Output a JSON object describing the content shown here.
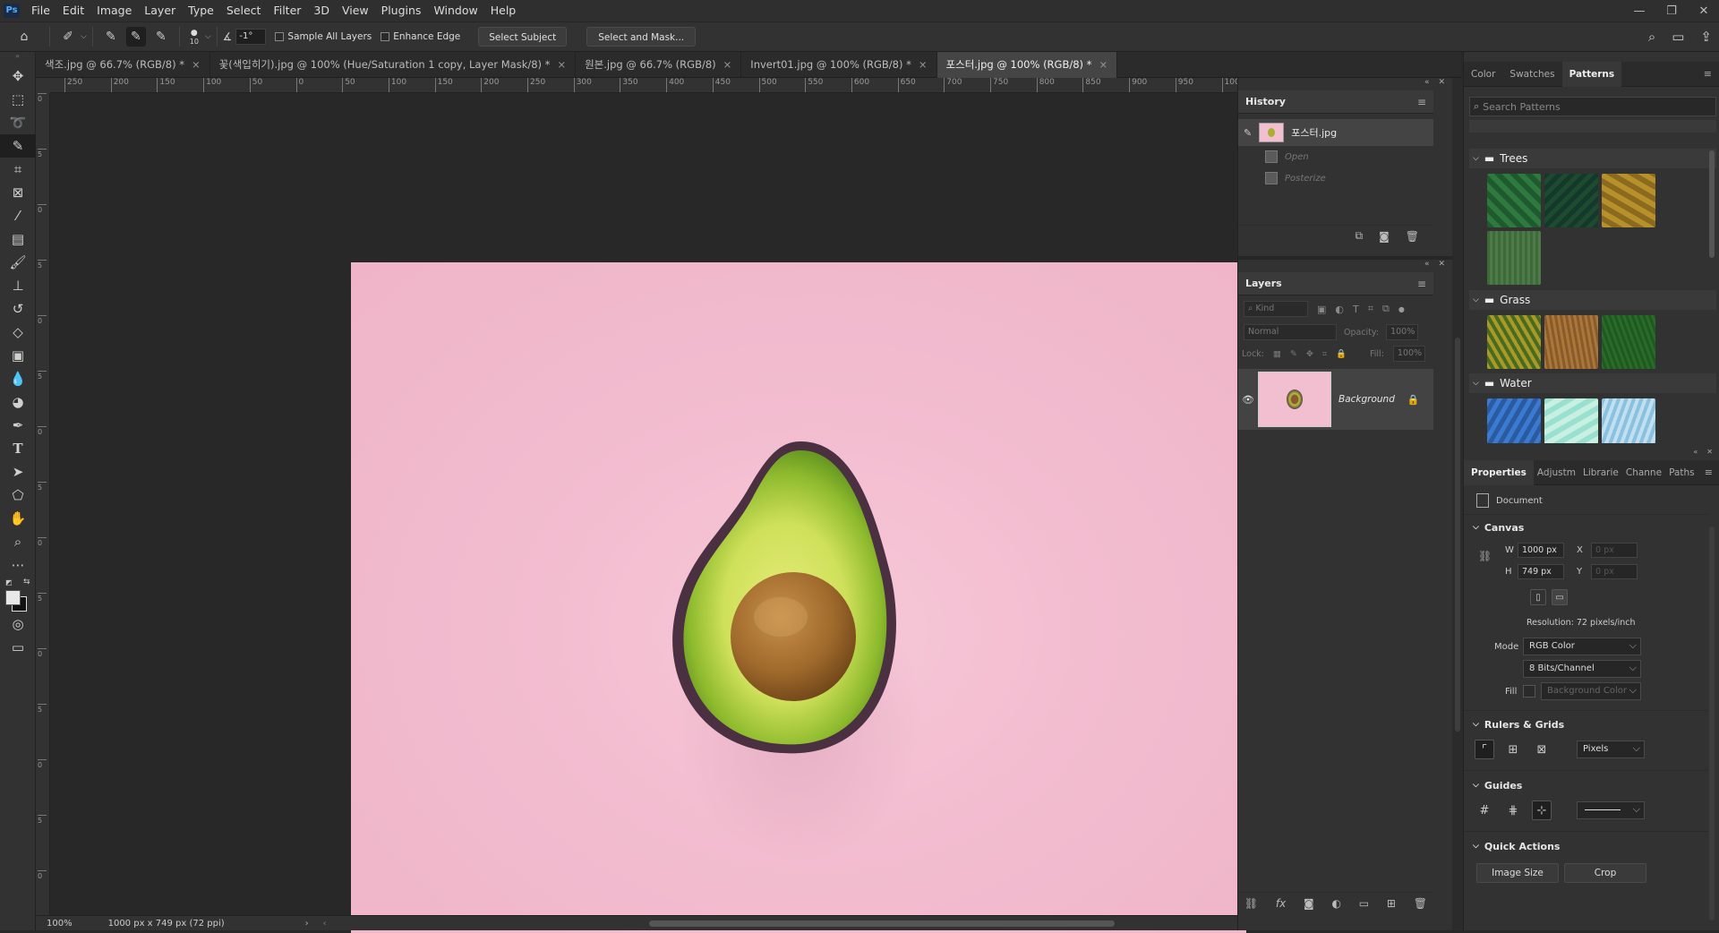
{
  "menubar": {
    "app_logo": "Ps",
    "items": [
      "File",
      "Edit",
      "Image",
      "Layer",
      "Type",
      "Select",
      "Filter",
      "3D",
      "View",
      "Plugins",
      "Window",
      "Help"
    ]
  },
  "options_bar": {
    "brush_size": "10",
    "angle_value": "-1°",
    "sample_all_layers": "Sample All Layers",
    "enhance_edge": "Enhance Edge",
    "select_subject": "Select Subject",
    "select_and_mask": "Select and Mask..."
  },
  "tabs": [
    {
      "label": "색조.jpg @ 66.7% (RGB/8) *",
      "active": false
    },
    {
      "label": "꽃(색입히기).jpg @ 100% (Hue/Saturation 1 copy, Layer Mask/8) *",
      "active": false
    },
    {
      "label": "원본.jpg @ 66.7% (RGB/8)",
      "active": false
    },
    {
      "label": "Invert01.jpg @ 100% (RGB/8) *",
      "active": false
    },
    {
      "label": "포스터.jpg @ 100% (RGB/8) *",
      "active": true
    }
  ],
  "ruler": {
    "h_ticks": [
      "250",
      "200",
      "150",
      "100",
      "50",
      "0",
      "50",
      "100",
      "150",
      "200",
      "250",
      "300",
      "350",
      "400",
      "450",
      "500",
      "550",
      "600",
      "650",
      "700",
      "750",
      "800",
      "850",
      "900",
      "950",
      "1000"
    ],
    "v_ticks": [
      "0",
      "5",
      "0",
      "5",
      "0",
      "5",
      "0",
      "5",
      "0",
      "5",
      "0",
      "5",
      "0",
      "5",
      "0"
    ]
  },
  "status_bar": {
    "zoom": "100%",
    "doc_info": "1000 px x 749 px (72 ppi)"
  },
  "history": {
    "title": "History",
    "snapshot_label": "포스터.jpg",
    "steps": [
      "Open",
      "Posterize"
    ]
  },
  "layers": {
    "title": "Layers",
    "filter_placeholder": "Kind",
    "blend_mode": "Normal",
    "opacity_label": "Opacity:",
    "opacity_value": "100%",
    "lock_label": "Lock:",
    "fill_label": "Fill:",
    "fill_value": "100%",
    "layer_name": "Background"
  },
  "right_tabs_top": [
    "Color",
    "Swatches",
    "Patterns"
  ],
  "patterns": {
    "search_placeholder": "Search Patterns",
    "groups": [
      {
        "name": "Trees",
        "colors": [
          "#1f5a2e",
          "#14382a",
          "#b8902a",
          "#3e6a3a"
        ]
      },
      {
        "name": "Grass",
        "colors": [
          "#a89a2a",
          "#a8783a",
          "#2a6a2a"
        ]
      },
      {
        "name": "Water",
        "colors": [
          "#3a7ad0",
          "#9ae0d0",
          "#8ac0e0"
        ]
      }
    ]
  },
  "right_tabs_bottom": [
    "Properties",
    "Adjustm",
    "Librarie",
    "Channe",
    "Paths"
  ],
  "properties": {
    "doc_label": "Document",
    "canvas_title": "Canvas",
    "w_label": "W",
    "w_value": "1000 px",
    "h_label": "H",
    "h_value": "749 px",
    "x_label": "X",
    "x_value": "0 px",
    "y_label": "Y",
    "y_value": "0 px",
    "resolution": "Resolution: 72 pixels/inch",
    "mode_label": "Mode",
    "mode_value": "RGB Color",
    "bits_value": "8 Bits/Channel",
    "fill_label": "Fill",
    "fill_value": "Background Color",
    "rulers_title": "Rulers & Grids",
    "units_value": "Pixels",
    "guides_title": "Guides",
    "quick_actions_title": "Quick Actions",
    "image_size_btn": "Image Size",
    "crop_btn": "Crop"
  },
  "colors": {
    "canvas_pink": "#f2bdd0",
    "panel_bg": "#323232",
    "app_bg": "#282828"
  }
}
